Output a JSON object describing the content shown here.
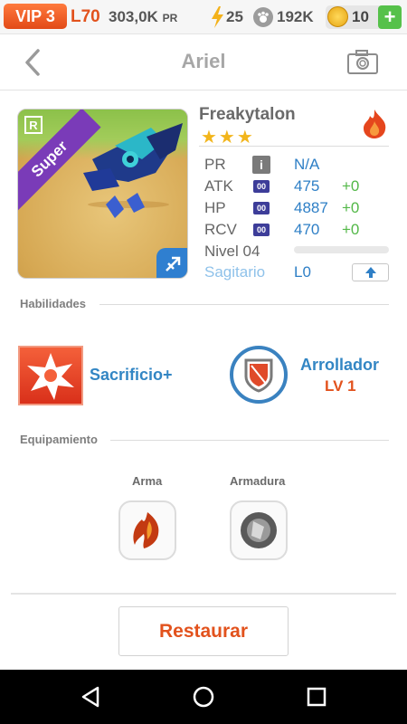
{
  "status": {
    "vip": "VIP 3",
    "level": "L70",
    "pr_value": "303,0K",
    "pr_unit": "PR",
    "energy": "25",
    "paw": "192K",
    "coins": "10",
    "add": "+"
  },
  "header": {
    "title": "Ariel",
    "icons": [
      "back-chevron-icon",
      "camera-icon"
    ]
  },
  "monster": {
    "card_band": "Super",
    "rarity_badge": "R",
    "name": "Freakytalon",
    "stars": "★★★",
    "stars_count": 3,
    "element": "fire",
    "level_progress": 0
  },
  "stats": {
    "pr": {
      "label": "PR",
      "value": "N/A",
      "icon": "i"
    },
    "atk": {
      "label": "ATK",
      "badge": "00",
      "value": "475",
      "bonus": "+0"
    },
    "hp": {
      "label": "HP",
      "badge": "00",
      "value": "4887",
      "bonus": "+0"
    },
    "rcv": {
      "label": "RCV",
      "badge": "00",
      "value": "470",
      "bonus": "+0"
    },
    "level_label": "Nivel 04",
    "sign": "Sagitario",
    "sign_level": "L0"
  },
  "sections": {
    "skills": "Habilidades",
    "equipment": "Equipamiento"
  },
  "skills": {
    "active": "Sacrificio+",
    "leader_name": "Arrollador",
    "leader_level": "LV 1"
  },
  "equipment": {
    "weapon": "Arma",
    "armor": "Armadura"
  },
  "actions": {
    "restore": "Restaurar"
  },
  "colors": {
    "accent_orange": "#e2521d",
    "stat_blue": "#2e7fc6",
    "bonus_green": "#53b848",
    "star_gold": "#f2b51b"
  }
}
